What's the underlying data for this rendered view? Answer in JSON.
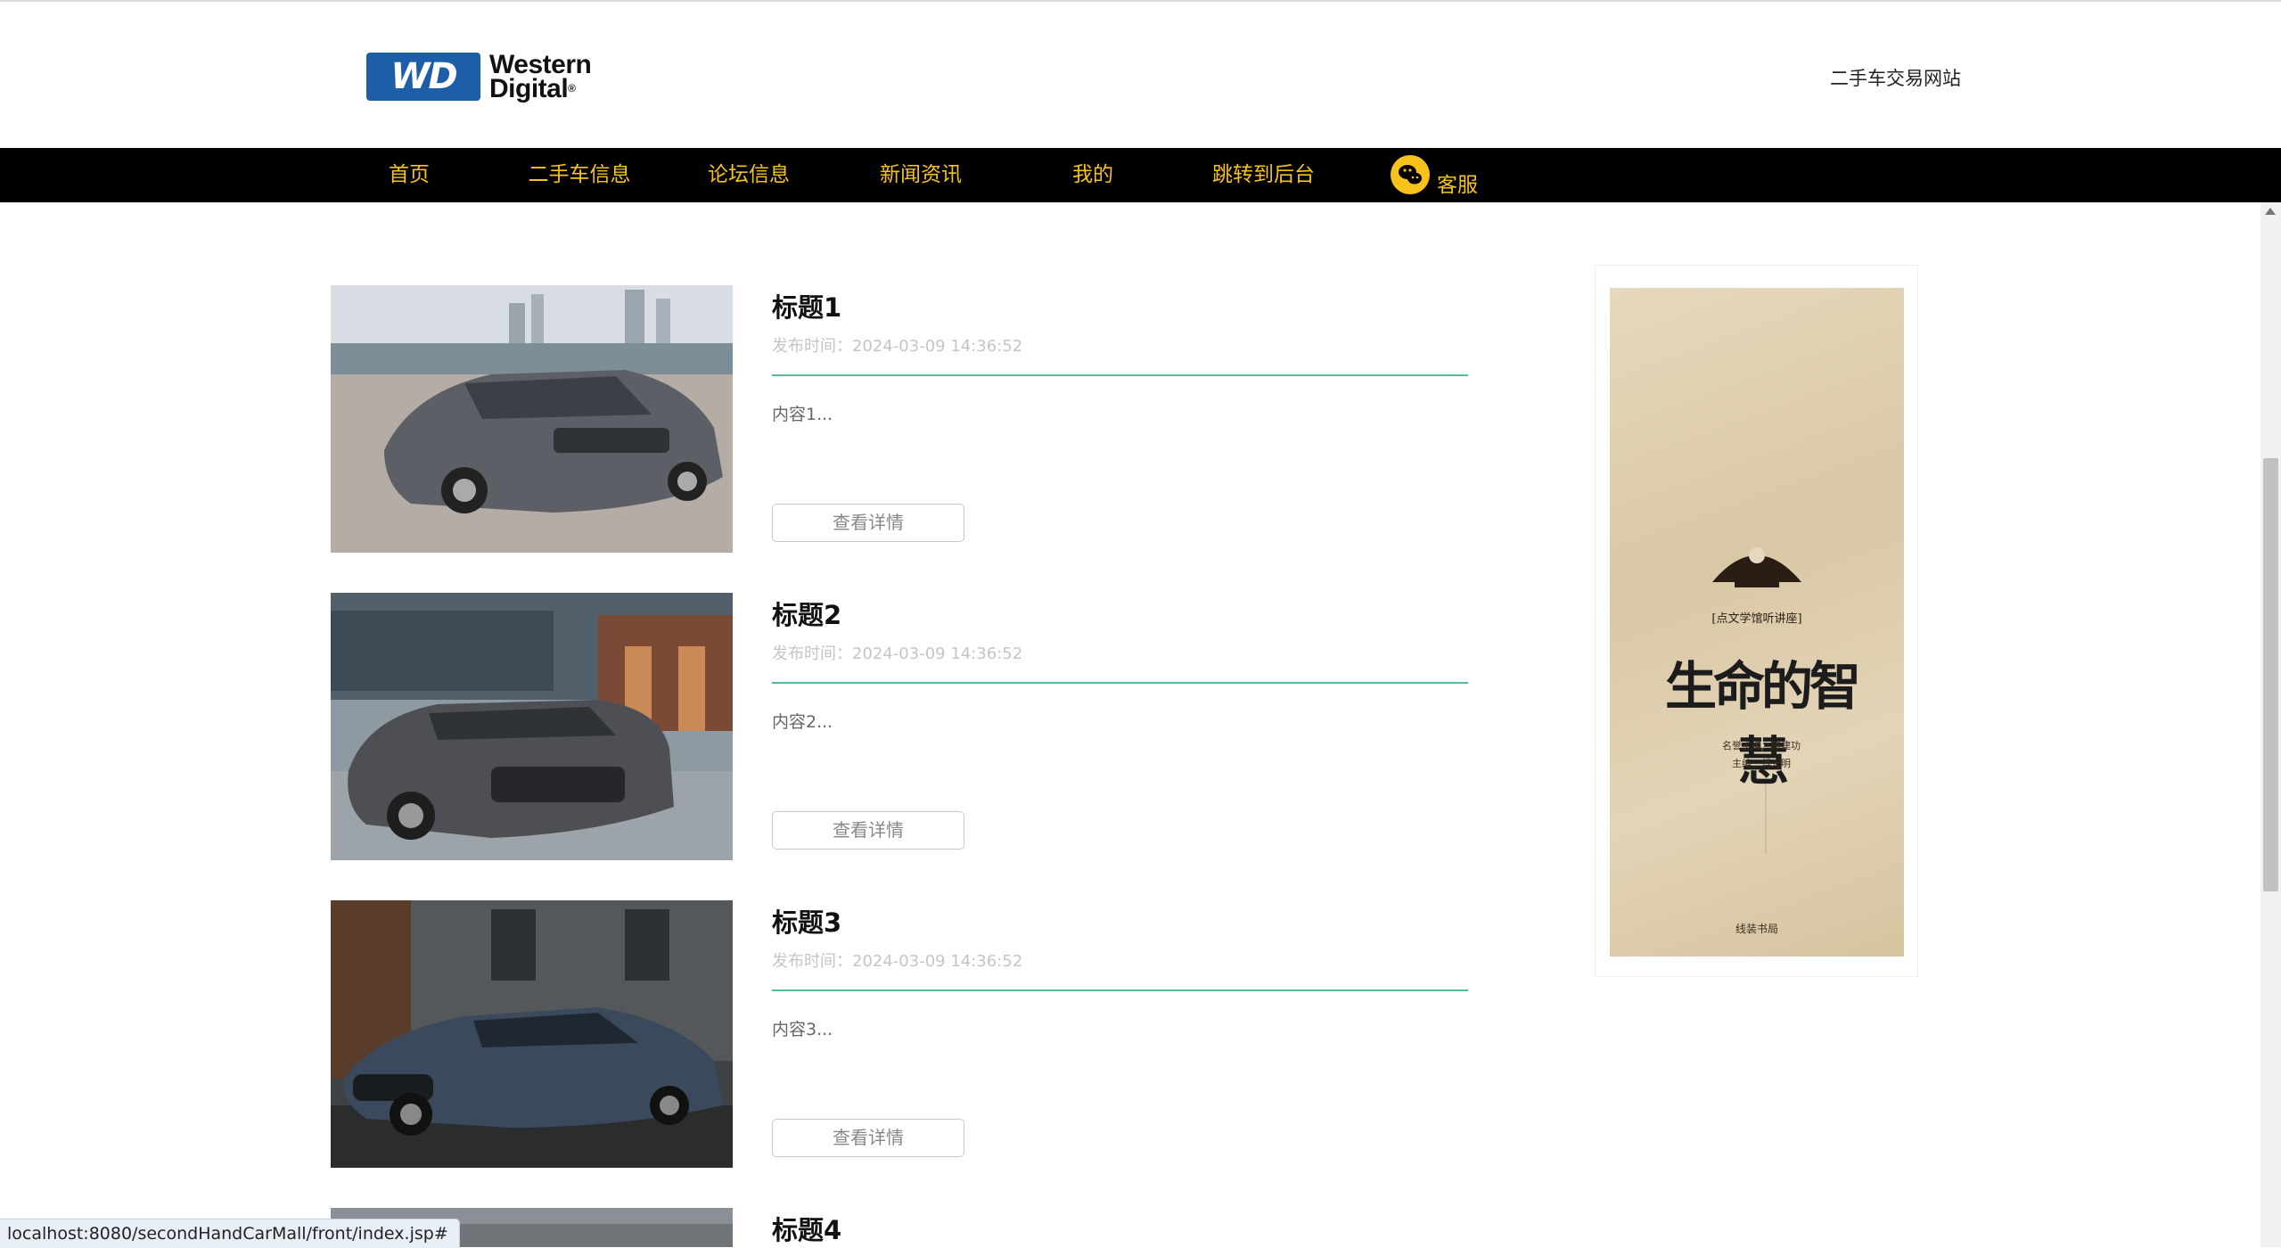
{
  "header": {
    "logo_badge": "WD",
    "logo_line1": "Western",
    "logo_line2": "Digital",
    "logo_mark": "®",
    "site_name": "二手车交易网站"
  },
  "nav": {
    "items": [
      {
        "label": "首页"
      },
      {
        "label": "二手车信息"
      },
      {
        "label": "论坛信息"
      },
      {
        "label": "新闻资讯"
      },
      {
        "label": "我的"
      },
      {
        "label": "跳转到后台"
      }
    ],
    "kefu_icon": "wechat-icon",
    "kefu_label": "客服"
  },
  "news": [
    {
      "title": "标题1",
      "time": "发布时间：2024-03-09 14:36:52",
      "summary": "内容1...",
      "button": "查看详情"
    },
    {
      "title": "标题2",
      "time": "发布时间：2024-03-09 14:36:52",
      "summary": "内容2...",
      "button": "查看详情"
    },
    {
      "title": "标题3",
      "time": "发布时间：2024-03-09 14:36:52",
      "summary": "内容3...",
      "button": "查看详情"
    },
    {
      "title": "标题4"
    }
  ],
  "ad": {
    "series_label": "[点文学馆听讲座]",
    "book_title": "生命的智慧",
    "editor_line1": "名誉主编：陈建功",
    "editor_line2": "主编：傅光明",
    "publisher": "线装书局"
  },
  "status_bar": {
    "url": "localhost:8080/secondHandCarMall/front/index.jsp#"
  },
  "colors": {
    "nav_bg": "#000000",
    "nav_text": "#f6c21b",
    "divider": "#58b89a",
    "logo_blue": "#1d5ea8"
  }
}
